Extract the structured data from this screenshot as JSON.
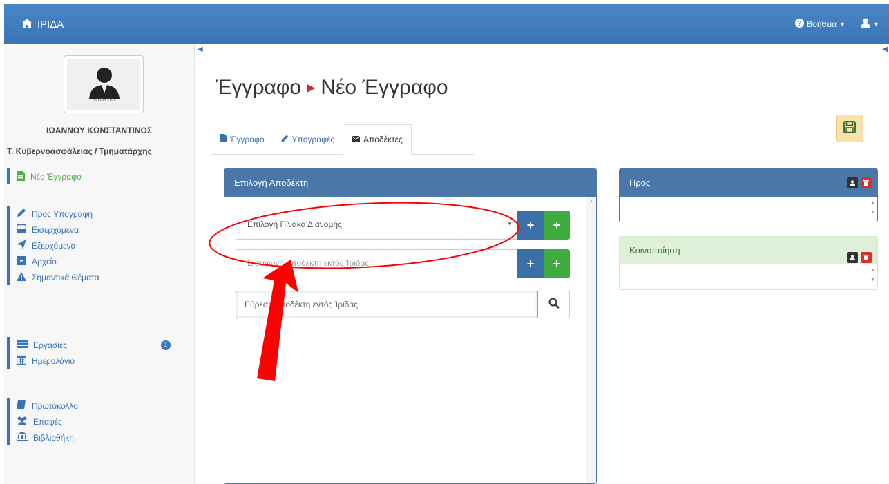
{
  "navbar": {
    "brand": "ΙΡΙΔΑ",
    "help_label": "Βοήθεια"
  },
  "sidebar": {
    "photo_label": "NO PHOTO",
    "user_name": "ΙΩΑΝΝΟΥ ΚΩΝΣΤΑΝΤΙΝΟΣ",
    "user_role": "Τ. Κυβερνοασφάλειας / Τμηματάρχης",
    "new_doc": "Νέο Έγγραφο",
    "group1": [
      "Προς Υπογραφή",
      "Εισερχόμενα",
      "Εξερχόμενα",
      "Αρχείο",
      "Σημαντικά Θέματα"
    ],
    "group2": [
      "Εργασίες",
      "Ημερολόγιο"
    ],
    "tasks_badge": "1",
    "group3": [
      "Πρωτόκολλο",
      "Επαφές",
      "Βιβλιοθήκη"
    ]
  },
  "main": {
    "title_part1": "Έγγραφο",
    "title_part2": "Νέο Έγγραφο",
    "tabs": [
      "Έγγραφο",
      "Υπογραφές",
      "Αποδέκτες"
    ]
  },
  "recipient_panel": {
    "title": "Επιλογή Αποδέκτη",
    "distribution_select": "Επιλογή Πίνακα Διανομής",
    "external_placeholder": "Εισαγωγή αποδέκτη εκτός Ίριδας",
    "search_placeholder": "Εύρεση αποδέκτη εντός Ίριδας"
  },
  "to_panel": {
    "title": "Προς"
  },
  "cc_panel": {
    "title": "Κοινοποίηση"
  },
  "colors": {
    "navbar": "#3a74b4",
    "panel_header": "#4a77a8",
    "add_blue": "#3a6fa8",
    "add_green": "#3eab3e",
    "delete_red": "#d9302c",
    "annotation_red": "#ff0000"
  }
}
